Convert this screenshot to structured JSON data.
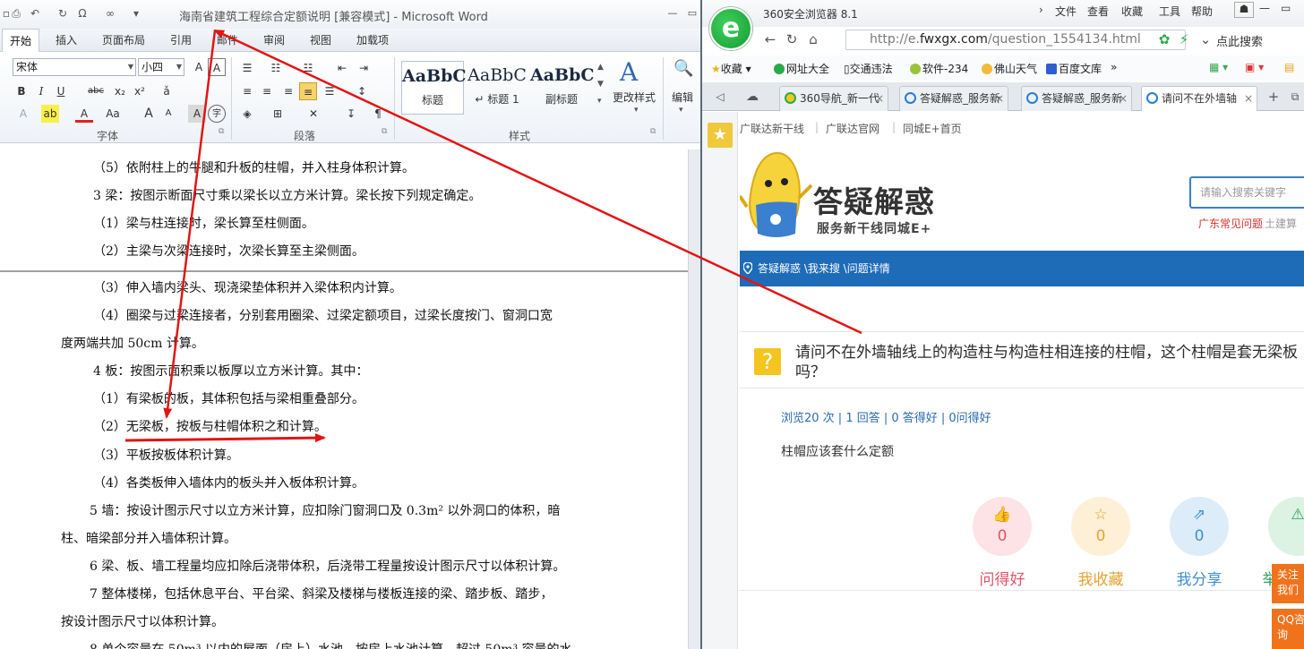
{
  "word": {
    "title": "海南省建筑工程综合定额说明 [兼容模式] - Microsoft Word",
    "qat_icons": [
      "save-icon",
      "print-icon",
      "undo-icon",
      "redo-icon",
      "omega-icon",
      "infinity-icon",
      "customize-icon"
    ],
    "quick_omega": "Ω",
    "quick_infinity": "∞",
    "tabs": [
      "开始",
      "插入",
      "页面布局",
      "引用",
      "邮件",
      "审阅",
      "视图",
      "加载项"
    ],
    "font_name": "宋体",
    "font_size": "小四",
    "bold": "B",
    "italic": "I",
    "underline": "U",
    "strike": "abc",
    "sub": "x₂",
    "sup": "x²",
    "text_effect": "A",
    "font_color": "A",
    "case": "Aa",
    "grow": "A",
    "shrink": "A",
    "char_border": "A",
    "enclose": "字",
    "group_font": "字体",
    "group_paragraph": "段落",
    "group_styles": "样式",
    "styles": [
      {
        "sample": "AaBbC",
        "caption": "标题"
      },
      {
        "sample": "AaBbC",
        "caption": "↵ 标题 1"
      },
      {
        "sample": "AaBbC",
        "caption": "副标题"
      }
    ],
    "change_styles": "更改样式",
    "edit": "编辑",
    "doc_lines": [
      "（5）依附柱上的牛腿和升板的柱帽，并入柱身体积计算。",
      "3 梁：按图示断面尺寸乘以梁长以立方米计算。梁长按下列规定确定。",
      "（1）梁与柱连接时，梁长算至柱侧面。",
      "（2）主梁与次梁连接时，次梁长算至主梁侧面。",
      "（3）伸入墙内梁头、现浇梁垫体积并入梁体积内计算。",
      "（4）圈梁与过梁连接者，分别套用圈梁、过梁定额项目，过梁长度按门、窗洞口宽",
      "度两端共加 50cm 计算。",
      "4 板：按图示面积乘以板厚以立方米计算。其中：",
      "（1）有梁板的板，其体积包括与梁相重叠部分。",
      "（2）无梁板，按板与柱帽体积之和计算。",
      "（3）平板按板体积计算。",
      "（4）各类板伸入墙体内的板头并入板体积计算。",
      "5 墙：按设计图示尺寸以立方米计算，应扣除门窗洞口及 0.3m² 以外洞口的体积，暗",
      "柱、暗梁部分并入墙体积计算。",
      "6 梁、板、墙工程量均应扣除后浇带体积，后浇带工程量按设计图示尺寸以体积计算。",
      "7 整体楼梯，包括休息平台、平台梁、斜梁及楼梯与楼板连接的梁、踏步板、踏步，",
      "按设计图示尺寸以体积计算。",
      "8 单个容量在 50m³ 以内的屋面（房上）水池，按房上水池计算，超过 50m³ 容量的水"
    ]
  },
  "browser": {
    "app_name": "360安全浏览器  8.1",
    "menu": [
      "文件",
      "查看",
      "收藏",
      "工具",
      "帮助"
    ],
    "url_scheme": "http://e.",
    "url_host": "fwxgx.com",
    "url_path": "/question_1554134.html",
    "search_placeholder": "点此搜索",
    "bookmarks": [
      "收藏",
      "网址大全",
      "交通违法",
      "软件-234",
      "佛山天气",
      "百度文库"
    ],
    "tabs": [
      "360导航_新一代",
      "答疑解惑_服务新",
      "答疑解惑_服务新",
      "请问不在外墙轴"
    ],
    "top_links": [
      "广联达新干线",
      "广联达官网",
      "同城E+首页"
    ],
    "site_name": "答疑解惑",
    "site_slogan": "服务新干线同城E+",
    "site_search_placeholder": "请输入搜索关键字",
    "hot_link_1": "广东常见问题",
    "hot_link_2": "土建算",
    "breadcrumb": "答疑解惑 \\我来搜 \\问题详情",
    "question_title": "请问不在外墙轴线上的构造柱与构造柱相连接的柱帽，这个柱帽是套无梁板吗？",
    "question_stats": "浏览20 次 | 1 回答 | 0 答得好 | 0问得好",
    "question_body": "柱帽应该套什么定额",
    "actions": [
      {
        "label": "问得好",
        "count": "0",
        "icon": "thumbs-up-icon",
        "color": "#e2546a",
        "bg": "#fde3e6"
      },
      {
        "label": "我收藏",
        "count": "0",
        "icon": "star-icon",
        "color": "#e3a330",
        "bg": "#fdf0d6"
      },
      {
        "label": "我分享",
        "count": "0",
        "icon": "share-icon",
        "color": "#3f8fd0",
        "bg": "#dcecf8"
      },
      {
        "label": "举",
        "count": "",
        "icon": "warning-icon",
        "color": "#2ea057",
        "bg": "#dcf3e3"
      }
    ],
    "follow": "关注我们",
    "qq": "QQ咨询"
  },
  "colors": {
    "accent_blue": "#1e6bb8",
    "annotation_red": "#e21414",
    "orange": "#f0731c"
  }
}
